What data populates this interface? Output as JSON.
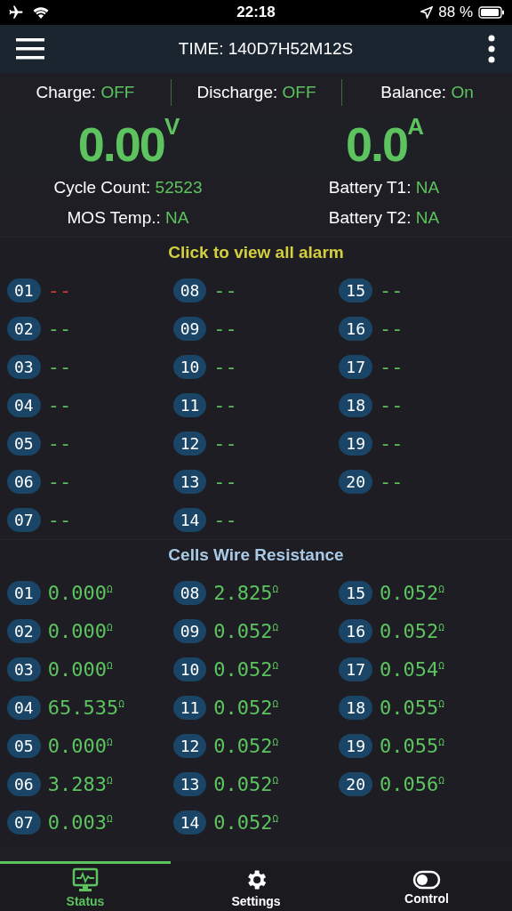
{
  "status_bar": {
    "time": "22:18",
    "battery_text": "88 %"
  },
  "header": {
    "title": "TIME: 140D7H52M12S"
  },
  "switches": [
    {
      "label": "Charge:",
      "value": "OFF"
    },
    {
      "label": "Discharge:",
      "value": "OFF"
    },
    {
      "label": "Balance:",
      "value": "On"
    }
  ],
  "readings": [
    {
      "value": "0.00",
      "unit": "V"
    },
    {
      "value": "0.0",
      "unit": "A"
    }
  ],
  "info": [
    {
      "label": "Cycle Count:",
      "value": "52523"
    },
    {
      "label": "Battery T1:",
      "value": "NA"
    },
    {
      "label": "MOS Temp.:",
      "value": "NA"
    },
    {
      "label": "Battery T2:",
      "value": "NA"
    }
  ],
  "alarms": {
    "title": "Click to view all alarm",
    "items": [
      {
        "index": "01",
        "value": "--",
        "active": true
      },
      {
        "index": "02",
        "value": "--",
        "active": false
      },
      {
        "index": "03",
        "value": "--",
        "active": false
      },
      {
        "index": "04",
        "value": "--",
        "active": false
      },
      {
        "index": "05",
        "value": "--",
        "active": false
      },
      {
        "index": "06",
        "value": "--",
        "active": false
      },
      {
        "index": "07",
        "value": "--",
        "active": false
      },
      {
        "index": "08",
        "value": "--",
        "active": false
      },
      {
        "index": "09",
        "value": "--",
        "active": false
      },
      {
        "index": "10",
        "value": "--",
        "active": false
      },
      {
        "index": "11",
        "value": "--",
        "active": false
      },
      {
        "index": "12",
        "value": "--",
        "active": false
      },
      {
        "index": "13",
        "value": "--",
        "active": false
      },
      {
        "index": "14",
        "value": "--",
        "active": false
      },
      {
        "index": "15",
        "value": "--",
        "active": false
      },
      {
        "index": "16",
        "value": "--",
        "active": false
      },
      {
        "index": "17",
        "value": "--",
        "active": false
      },
      {
        "index": "18",
        "value": "--",
        "active": false
      },
      {
        "index": "19",
        "value": "--",
        "active": false
      },
      {
        "index": "20",
        "value": "--",
        "active": false
      }
    ]
  },
  "resistance": {
    "title": "Cells Wire Resistance",
    "items": [
      {
        "index": "01",
        "value": "0.000",
        "unit": "Ω"
      },
      {
        "index": "02",
        "value": "0.000",
        "unit": "Ω"
      },
      {
        "index": "03",
        "value": "0.000",
        "unit": "Ω"
      },
      {
        "index": "04",
        "value": "65.535",
        "unit": "Ω"
      },
      {
        "index": "05",
        "value": "0.000",
        "unit": "Ω"
      },
      {
        "index": "06",
        "value": "3.283",
        "unit": "Ω"
      },
      {
        "index": "07",
        "value": "0.003",
        "unit": "Ω"
      },
      {
        "index": "08",
        "value": "2.825",
        "unit": "Ω"
      },
      {
        "index": "09",
        "value": "0.052",
        "unit": "Ω"
      },
      {
        "index": "10",
        "value": "0.052",
        "unit": "Ω"
      },
      {
        "index": "11",
        "value": "0.052",
        "unit": "Ω"
      },
      {
        "index": "12",
        "value": "0.052",
        "unit": "Ω"
      },
      {
        "index": "13",
        "value": "0.052",
        "unit": "Ω"
      },
      {
        "index": "14",
        "value": "0.052",
        "unit": "Ω"
      },
      {
        "index": "15",
        "value": "0.052",
        "unit": "Ω"
      },
      {
        "index": "16",
        "value": "0.052",
        "unit": "Ω"
      },
      {
        "index": "17",
        "value": "0.054",
        "unit": "Ω"
      },
      {
        "index": "18",
        "value": "0.055",
        "unit": "Ω"
      },
      {
        "index": "19",
        "value": "0.055",
        "unit": "Ω"
      },
      {
        "index": "20",
        "value": "0.056",
        "unit": "Ω"
      }
    ]
  },
  "tabs": [
    {
      "kind": "status",
      "label": "Status",
      "selected": true
    },
    {
      "kind": "settings",
      "label": "Settings",
      "selected": false
    },
    {
      "kind": "control",
      "label": "Control",
      "selected": false
    }
  ]
}
